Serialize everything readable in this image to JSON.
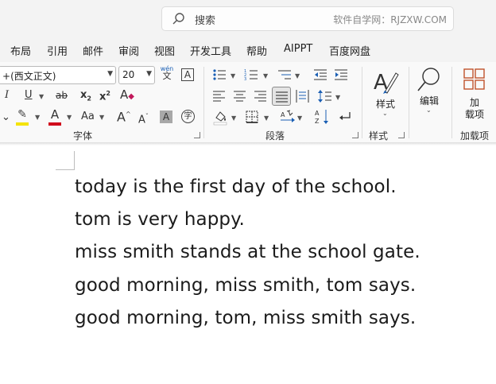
{
  "titlebar": {
    "search_placeholder": "搜索",
    "watermark": "软件自学网：RJZXW.COM"
  },
  "menu": {
    "tabs": [
      "布局",
      "引用",
      "邮件",
      "审阅",
      "视图",
      "开发工具",
      "帮助",
      "AIPPT",
      "百度网盘"
    ]
  },
  "ribbon": {
    "font_name": "(西文正文)",
    "font_name_prefix": "+",
    "font_size": "20",
    "phonetic_top": "wén",
    "phonetic_bottom": "文",
    "char_border": "A",
    "italic": "I",
    "underline": "U",
    "strike": "ab",
    "subscript": "x",
    "subscript_mark": "2",
    "superscript": "x",
    "superscript_mark": "2",
    "clear_format": "A",
    "font_color": "A",
    "change_case": "Aa",
    "grow_font": "A",
    "shrink_font": "A",
    "char_shading": "A",
    "enclose_char": "字",
    "groups": {
      "font": "字体",
      "paragraph": "段落",
      "styles": "样式",
      "addins": "加载项"
    },
    "styles_label": "样式",
    "edit_label": "编辑",
    "addin_label_line1": "加",
    "addin_label_line2": "载项",
    "highlight_color": "#f4e300",
    "font_color_bar": "#d0021b",
    "addin_color": "#c0522c"
  },
  "document": {
    "lines": [
      "today is the first day of the school.",
      "tom is very happy.",
      "miss smith stands at the school gate.",
      "good morning, miss smith, tom says.",
      "good morning, tom, miss smith says."
    ]
  }
}
